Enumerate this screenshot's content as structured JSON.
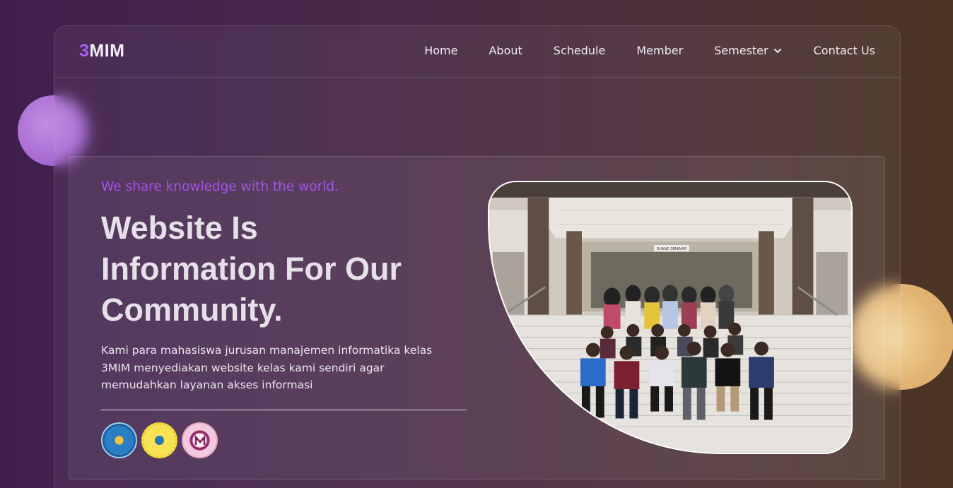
{
  "brand": {
    "accent": "3",
    "rest": "MIM",
    "accent_color": "#a95ef0"
  },
  "nav": {
    "items": [
      {
        "label": "Home"
      },
      {
        "label": "About"
      },
      {
        "label": "Schedule"
      },
      {
        "label": "Member"
      },
      {
        "label": "Semester",
        "icon": "chevron-down-icon"
      },
      {
        "label": "Contact Us"
      }
    ]
  },
  "hero": {
    "tagline": "We share knowledge with the world.",
    "headline_line1": "Website Is",
    "headline_line2": "Information For Our",
    "headline_line3": "Community.",
    "description": "Kami para mahasiswa jurusan manajemen informatika kelas 3MIM menyediakan website kelas kami sendiri agar memudahkan layanan akses informasi",
    "logos": [
      "tut-wuri-handayani-logo",
      "university-seal-logo",
      "department-seal-logo"
    ],
    "photo": {
      "sign_text": "RUANG SEMINAR",
      "subject": "class group photo on building steps"
    }
  },
  "colors": {
    "tagline": "#a553e6",
    "headline": "#e6e1e8",
    "orb_purple": "#a566d2",
    "orb_gold": "#e2b472"
  }
}
